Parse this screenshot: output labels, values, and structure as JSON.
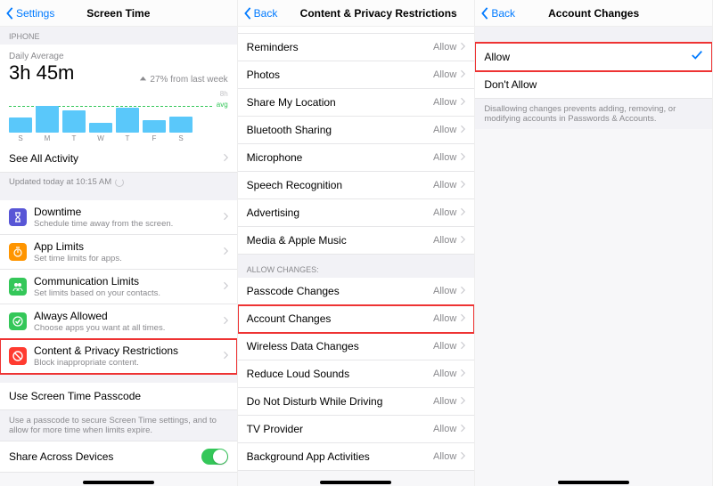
{
  "pane1": {
    "back_label": "Settings",
    "title": "Screen Time",
    "section_device": "IPHONE",
    "daily_avg_label": "Daily Average",
    "daily_avg_value": "3h 45m",
    "delta_text": "27% from last week",
    "hours_marker": "8h",
    "avg_marker": "avg",
    "days": [
      "S",
      "M",
      "T",
      "W",
      "T",
      "F",
      "S"
    ],
    "see_all": "See All Activity",
    "updated_text": "Updated today at 10:15 AM",
    "items": [
      {
        "title": "Downtime",
        "sub": "Schedule time away from the screen.",
        "icon": "hourglass",
        "color": "purple"
      },
      {
        "title": "App Limits",
        "sub": "Set time limits for apps.",
        "icon": "timer",
        "color": "orange"
      },
      {
        "title": "Communication Limits",
        "sub": "Set limits based on your contacts.",
        "icon": "people",
        "color": "green"
      },
      {
        "title": "Always Allowed",
        "sub": "Choose apps you want at all times.",
        "icon": "check",
        "color": "green2"
      },
      {
        "title": "Content & Privacy Restrictions",
        "sub": "Block inappropriate content.",
        "icon": "nope",
        "color": "red"
      }
    ],
    "passcode_link": "Use Screen Time Passcode",
    "passcode_footer": "Use a passcode to secure Screen Time settings, and to allow for more time when limits expire.",
    "share_label": "Share Across Devices"
  },
  "pane2": {
    "back_label": "Back",
    "title": "Content & Privacy Restrictions",
    "items_top": [
      {
        "label": "Reminders",
        "value": "Allow"
      },
      {
        "label": "Photos",
        "value": "Allow"
      },
      {
        "label": "Share My Location",
        "value": "Allow"
      },
      {
        "label": "Bluetooth Sharing",
        "value": "Allow"
      },
      {
        "label": "Microphone",
        "value": "Allow"
      },
      {
        "label": "Speech Recognition",
        "value": "Allow"
      },
      {
        "label": "Advertising",
        "value": "Allow"
      },
      {
        "label": "Media & Apple Music",
        "value": "Allow"
      }
    ],
    "allow_changes_header": "ALLOW CHANGES:",
    "items_bottom": [
      {
        "label": "Passcode Changes",
        "value": "Allow"
      },
      {
        "label": "Account Changes",
        "value": "Allow",
        "hl": true
      },
      {
        "label": "Wireless Data Changes",
        "value": "Allow"
      },
      {
        "label": "Reduce Loud Sounds",
        "value": "Allow"
      },
      {
        "label": "Do Not Disturb While Driving",
        "value": "Allow"
      },
      {
        "label": "TV Provider",
        "value": "Allow"
      },
      {
        "label": "Background App Activities",
        "value": "Allow"
      }
    ]
  },
  "pane3": {
    "back_label": "Back",
    "title": "Account Changes",
    "options": [
      {
        "label": "Allow",
        "selected": true,
        "hl": true
      },
      {
        "label": "Don't Allow",
        "selected": false
      }
    ],
    "footer": "Disallowing changes prevents adding, removing, or modifying accounts in Passwords & Accounts."
  },
  "chart_data": {
    "type": "bar",
    "categories": [
      "S",
      "M",
      "T",
      "W",
      "T",
      "F",
      "S"
    ],
    "values": [
      2.8,
      5.0,
      4.2,
      1.8,
      4.6,
      2.3,
      3.0
    ],
    "average": 3.75,
    "ylim": [
      0,
      8
    ],
    "ylabel": "hours",
    "title": "Daily Average 3h 45m"
  }
}
